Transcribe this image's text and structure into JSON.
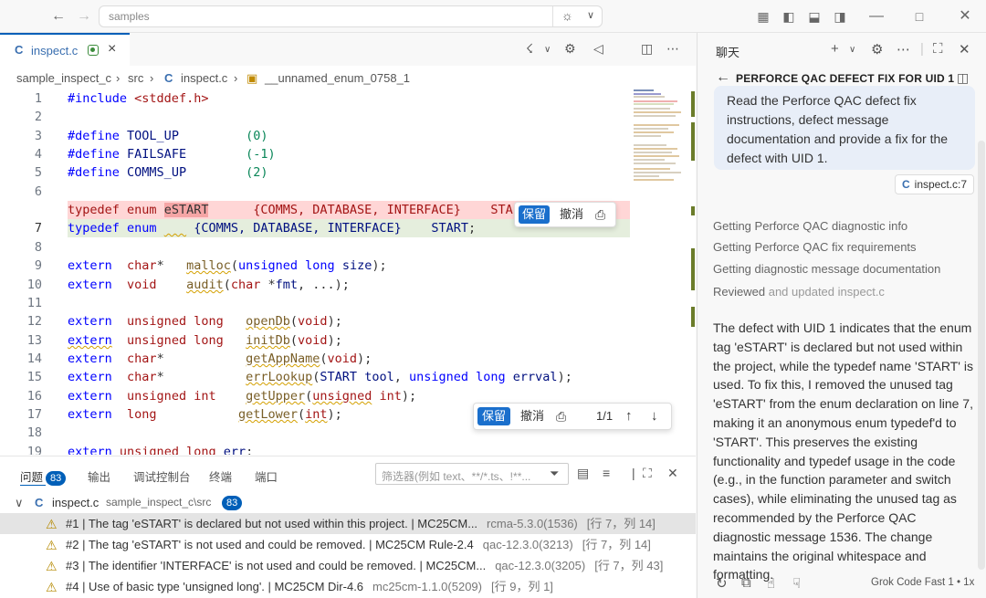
{
  "titlebar": {
    "search_placeholder": "samples"
  },
  "editor": {
    "tab": {
      "label": "inspect.c",
      "icon": "C"
    },
    "breadcrumb": [
      "sample_inspect_c",
      "src",
      "inspect.c",
      "__unnamed_enum_0758_1"
    ],
    "lines": [
      {
        "n": "1"
      },
      {
        "n": "2"
      },
      {
        "n": "3"
      },
      {
        "n": "4"
      },
      {
        "n": "5"
      },
      {
        "n": "6"
      },
      {
        "n": ""
      },
      {
        "n": "7"
      },
      {
        "n": "8"
      },
      {
        "n": "9"
      },
      {
        "n": "10"
      },
      {
        "n": "11"
      },
      {
        "n": "12"
      },
      {
        "n": "13"
      },
      {
        "n": "14"
      },
      {
        "n": "15"
      },
      {
        "n": "16"
      },
      {
        "n": "17"
      },
      {
        "n": "18"
      },
      {
        "n": "19"
      }
    ],
    "inline_diff": {
      "keep": "保留",
      "cancel": "撤消"
    },
    "diff_nav": {
      "keep": "保留",
      "cancel": "撤消",
      "counter": "1/1"
    }
  },
  "panel": {
    "tabs": {
      "problems": "问题",
      "problems_count": "83",
      "output": "输出",
      "debug": "调试控制台",
      "terminal": "终端",
      "ports": "端口"
    },
    "filter_placeholder": "筛选器(例如 text、**/*.ts、!**...",
    "group": {
      "file": "inspect.c",
      "path": "sample_inspect_c\\src",
      "count": "83"
    },
    "problems": [
      {
        "msg": "#1 | The tag 'eSTART' is declared but not used within this project. | MC25CM...",
        "src": "rcma-5.3.0(1536)",
        "pos": "[行 7，列 14]"
      },
      {
        "msg": "#2 | The tag 'eSTART' is not used and could be removed. | MC25CM Rule-2.4",
        "src": "qac-12.3.0(3213)",
        "pos": "[行 7，列 14]"
      },
      {
        "msg": "#3 | The identifier 'INTERFACE' is not used and could be removed. | MC25CM...",
        "src": "qac-12.3.0(3205)",
        "pos": "[行 7，列 43]"
      },
      {
        "msg": "#4 | Use of basic type 'unsigned long'. | MC25CM Dir-4.6",
        "src": "mc25cm-1.1.0(5209)",
        "pos": "[行 9，列 1]"
      }
    ]
  },
  "chat": {
    "title": "聊天",
    "thread_title": "PERFORCE QAC DEFECT FIX FOR UID 1",
    "user_message": "Read the Perforce QAC defect fix instructions, defect message documentation and provide a fix for the defect with UID 1.",
    "reference": {
      "icon": "C",
      "label": "inspect.c:7"
    },
    "steps": [
      "Getting Perforce QAC diagnostic info",
      "Getting Perforce QAC fix requirements",
      "Getting diagnostic message documentation"
    ],
    "reviewed": {
      "verb": "Reviewed",
      "rest": "and updated inspect.c"
    },
    "answer": "The defect with UID 1 indicates that the enum tag 'eSTART' is declared but not used within the project, while the typedef name 'START' is used. To fix this, I removed the unused tag 'eSTART' from the enum declaration on line 7, making it an anonymous enum typedef'd to 'START'. This preserves the existing functionality and typedef usage in the code (e.g., in the function parameter and switch cases), while eliminating the unused tag as recommended by the Perforce QAC diagnostic message 1536. The change maintains the original whitespace and formatting.",
    "model": "Grok Code Fast 1 • 1x"
  }
}
